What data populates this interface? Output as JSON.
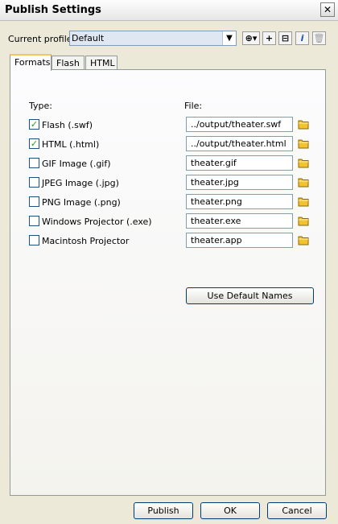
{
  "window": {
    "title": "Publish Settings",
    "close_glyph": "✕"
  },
  "profile": {
    "label": "Current profile:",
    "value": "Default",
    "buttons": [
      {
        "name": "import-export-profile",
        "glyph": "⊕▾"
      },
      {
        "name": "create-profile",
        "glyph": "+"
      },
      {
        "name": "duplicate-profile",
        "glyph": "⊟"
      },
      {
        "name": "profile-properties",
        "glyph": "i"
      },
      {
        "name": "delete-profile",
        "glyph": "🗑"
      }
    ]
  },
  "tabs": [
    "Formats",
    "Flash",
    "HTML"
  ],
  "active_tab": "Formats",
  "formats": {
    "type_header": "Type:",
    "file_header": "File:",
    "rows": [
      {
        "label": "Flash  (.swf)",
        "checked": true,
        "file": "../output/theater.swf"
      },
      {
        "label": "HTML  (.html)",
        "checked": true,
        "file": "../output/theater.html"
      },
      {
        "label": "GIF Image  (.gif)",
        "checked": false,
        "file": "theater.gif"
      },
      {
        "label": "JPEG Image  (.jpg)",
        "checked": false,
        "file": "theater.jpg"
      },
      {
        "label": "PNG Image  (.png)",
        "checked": false,
        "file": "theater.png"
      },
      {
        "label": "Windows Projector  (.exe)",
        "checked": false,
        "file": "theater.exe"
      },
      {
        "label": "Macintosh Projector",
        "checked": false,
        "file": "theater.app"
      }
    ],
    "use_default_names": "Use Default Names"
  },
  "footer": {
    "publish": "Publish",
    "ok": "OK",
    "cancel": "Cancel"
  },
  "colors": {
    "accent_tab": "#f7c55b",
    "folder_icon": "#f2c230",
    "check": "#21a121"
  }
}
